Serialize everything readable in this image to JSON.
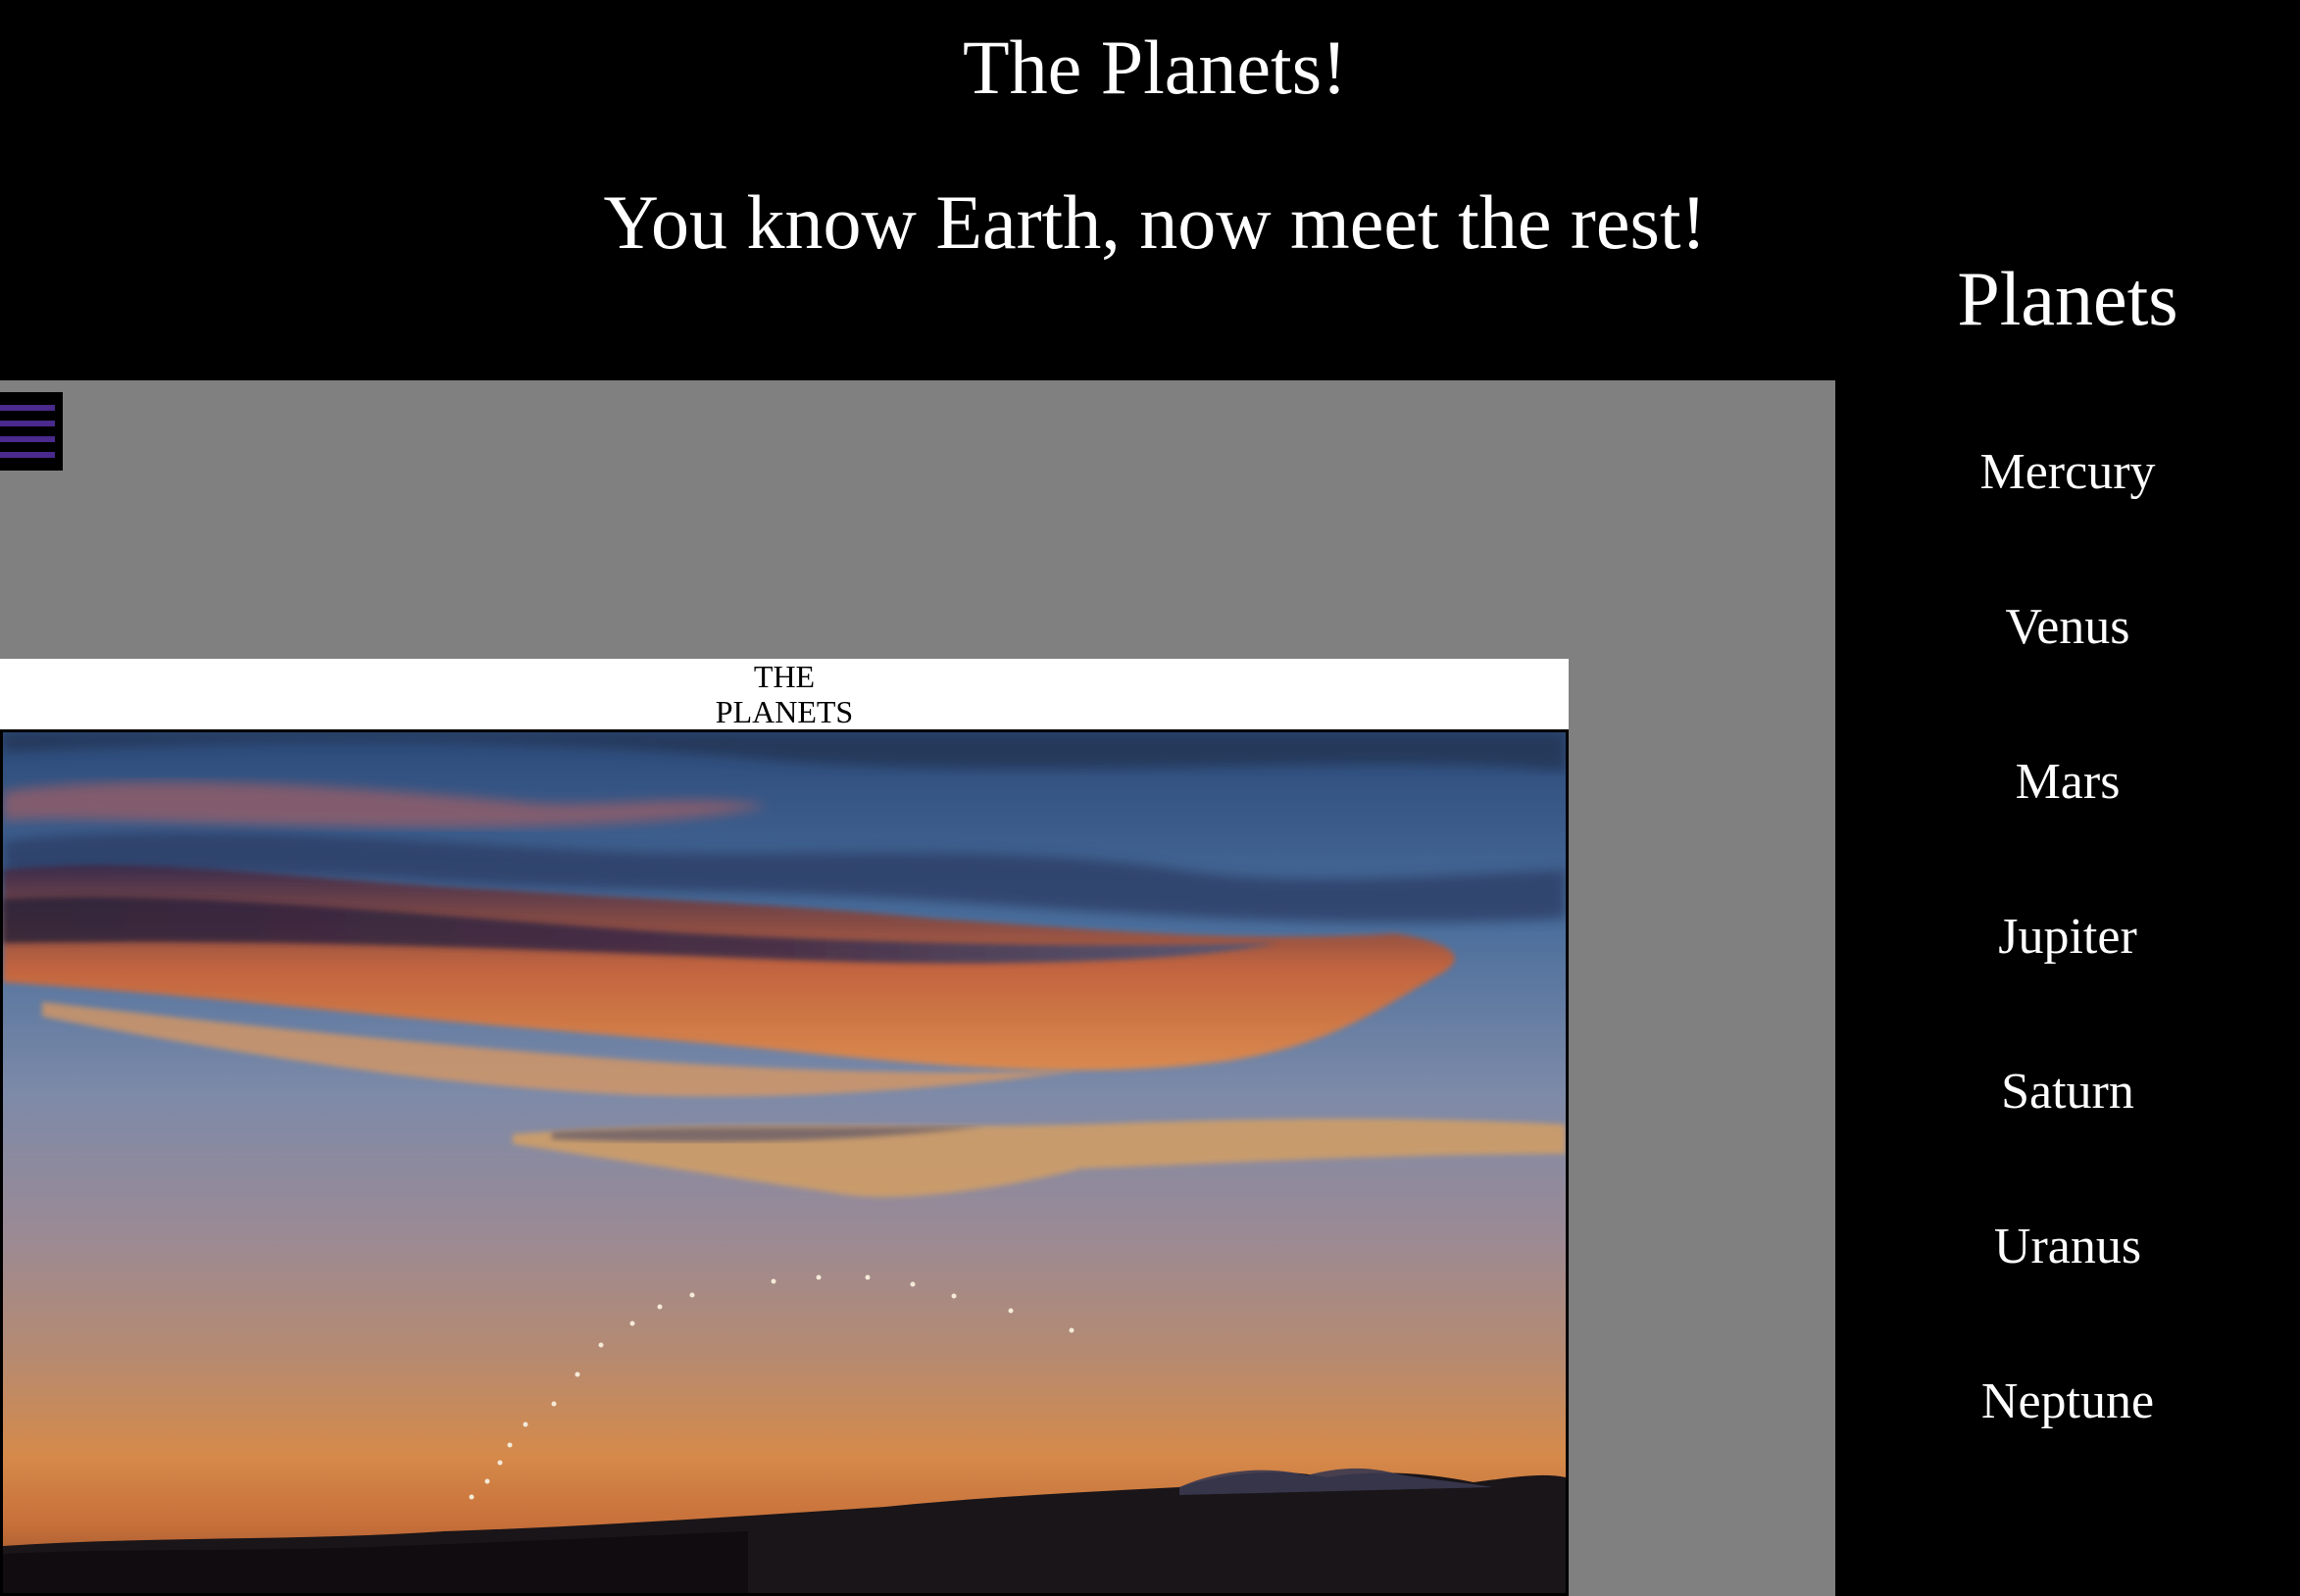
{
  "header": {
    "title": "The Planets!",
    "subtitle": "You know Earth, now meet the rest!"
  },
  "menu_toggle": {
    "icon": "hamburger-menu-icon",
    "color": "#4a2a8c"
  },
  "banner": {
    "caption_line1": "THE",
    "caption_line2": "PLANETS",
    "image": "sunset-sky-with-planet-arc"
  },
  "sidebar": {
    "heading": "Planets",
    "items": [
      {
        "label": "Mercury"
      },
      {
        "label": "Venus"
      },
      {
        "label": "Mars"
      },
      {
        "label": "Jupiter"
      },
      {
        "label": "Saturn"
      },
      {
        "label": "Uranus"
      },
      {
        "label": "Neptune"
      }
    ]
  },
  "colors": {
    "page_background": "#000000",
    "main_panel": "#808080",
    "text": "#ffffff"
  }
}
